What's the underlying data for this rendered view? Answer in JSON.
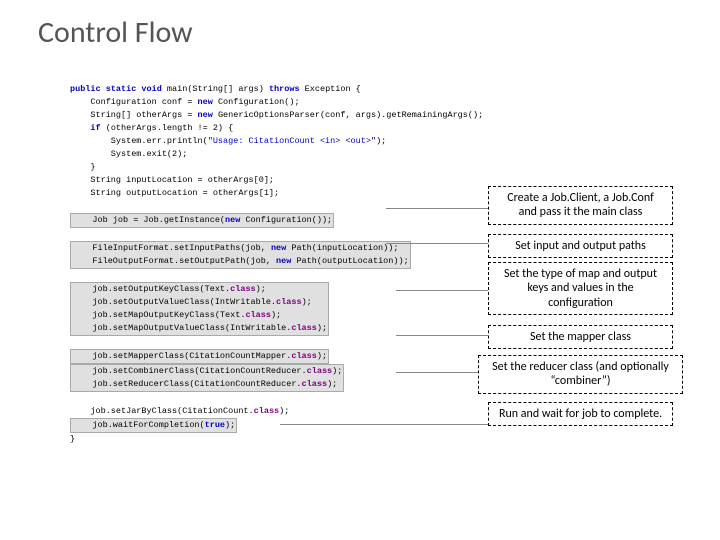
{
  "title": "Control Flow",
  "code": {
    "l1a": "public static void ",
    "l1b": "main(String[] args) ",
    "l1c": "throws ",
    "l1d": "Exception {",
    "l2a": "    Configuration conf = ",
    "l2b": "new ",
    "l2c": "Configuration();",
    "l3a": "    String[] otherArgs = ",
    "l3b": "new ",
    "l3c": "GenericOptionsParser(conf, args).getRemainingArgs();",
    "l4a": "    if ",
    "l4b": "(otherArgs.length != 2) {",
    "l5a": "        System.err.println(",
    "l5b": "\"Usage: CitationCount <in> <out>\"",
    "l5c": ");",
    "l6": "        System.exit(2);",
    "l7": "    }",
    "l8": "    String inputLocation = otherArgs[0];",
    "l9": "    String outputLocation = otherArgs[1];",
    "l10a": "    Job job = Job.getInstance(",
    "l10b": "new ",
    "l10c": "Configuration());",
    "l11a": "    FileInputFormat.setInputPaths(job, ",
    "l11b": "new ",
    "l11c": "Path(inputLocation));",
    "l12a": "    FileOutputFormat.setOutputPath(job, ",
    "l12b": "new ",
    "l12c": "Path(outputLocation));",
    "l13a": "    job.setOutputKeyClass(Text.",
    "l13b": "class",
    "l13c": ");",
    "l14a": "    job.setOutputValueClass(IntWritable.",
    "l14b": "class",
    "l14c": ");",
    "l15a": "    job.setMapOutputKeyClass(Text.",
    "l15b": "class",
    "l15c": ");",
    "l16a": "    job.setMapOutputValueClass(IntWritable.",
    "l16b": "class",
    "l16c": ");",
    "l17a": "    job.setMapperClass(CitationCountMapper.",
    "l17b": "class",
    "l17c": ");",
    "l18a": "    job.setCombinerClass(CitationCountReducer.",
    "l18b": "class",
    "l18c": ");",
    "l19a": "    job.setReducerClass(CitationCountReducer.",
    "l19b": "class",
    "l19c": ");",
    "l20a": "    job.setJarByClass(CitationCount.",
    "l20b": "class",
    "l20c": ");",
    "l21a": "    job.waitForCompletion(",
    "l21b": "true",
    "l21c": ");",
    "l22": "}"
  },
  "annot": {
    "a1": "Create a Job.Client, a Job.Conf and pass it the main class",
    "a2": "Set input and output paths",
    "a3": "Set the type of map and output keys and values in the configuration",
    "a4": "Set the mapper class",
    "a5": "Set the reducer class (and optionally “combiner”)",
    "a6": "Run and wait for job to complete."
  }
}
